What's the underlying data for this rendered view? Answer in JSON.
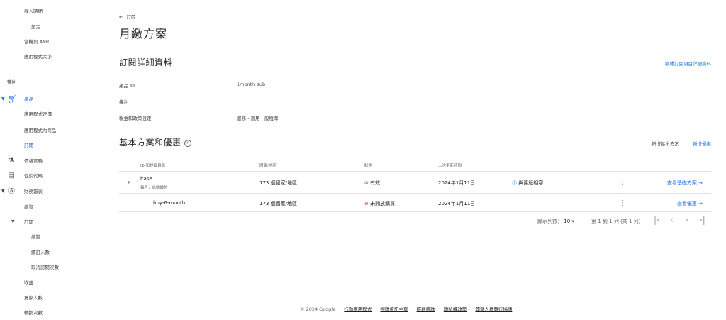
{
  "sidebar": {
    "items": [
      {
        "label": "載入時間"
      },
      {
        "label": "設定"
      },
      {
        "label": "當機與 ANR"
      },
      {
        "label": "應用程式大小"
      },
      {
        "label": "營利"
      },
      {
        "label": "產品"
      },
      {
        "label": "應用程式定價"
      },
      {
        "label": "應用程式內商品"
      },
      {
        "label": "訂閱"
      },
      {
        "label": "價格實驗"
      },
      {
        "label": "促銷代碼"
      },
      {
        "label": "財務報表"
      },
      {
        "label": "總覽"
      },
      {
        "label": "訂閱"
      },
      {
        "label": "總覽"
      },
      {
        "label": "續訂人數"
      },
      {
        "label": "取消訂閱次數"
      },
      {
        "label": "收益"
      },
      {
        "label": "買家人數"
      },
      {
        "label": "轉換次數"
      }
    ]
  },
  "header": {
    "back_label": "訂閱",
    "title": "月繳方案"
  },
  "details": {
    "title": "訂閱詳細資料",
    "edit_link": "編輯訂閱項目詳細資料",
    "rows": [
      {
        "label": "產品 ID",
        "value": "1month_sub"
      },
      {
        "label": "權利",
        "value": "-"
      },
      {
        "label": "稅金和政策設定",
        "value": "服務 - 適用一般稅率"
      }
    ]
  },
  "plans": {
    "title": "基本方案和優惠",
    "help_icon": "?",
    "add_base_plan": "新增基本方案",
    "add_offer": "新增優惠",
    "columns": [
      "ID 和詳細目錄",
      "國家/地區",
      "狀態",
      "上次更新時間"
    ],
    "rows": [
      {
        "id": "base",
        "sub": "每月，自動續約",
        "regions": "173 個國家/地區",
        "status": "有效",
        "updated": "2024年1月11日",
        "badge": "與舊版相容",
        "action": "查看基礎方案"
      },
      {
        "id": "buy-6-month",
        "sub": "",
        "regions": "173 個國家/地區",
        "status": "未開放購買",
        "updated": "2024年1月11日",
        "badge": "",
        "action": "查看優惠"
      }
    ],
    "pager": {
      "rows_label": "顯示列數：",
      "rows_value": "10",
      "range": "第 1 到 1 列 (共 1 列)"
    }
  },
  "footer": {
    "copyright": "© 2024 Google",
    "links": [
      "行動應用程式",
      "視隱資訊主頁",
      "服務條款",
      "隱私權政策",
      "開發人員發行協議"
    ]
  },
  "colors": {
    "accent": "#1a73e8",
    "ok": "#188038",
    "error": "#d93025"
  }
}
